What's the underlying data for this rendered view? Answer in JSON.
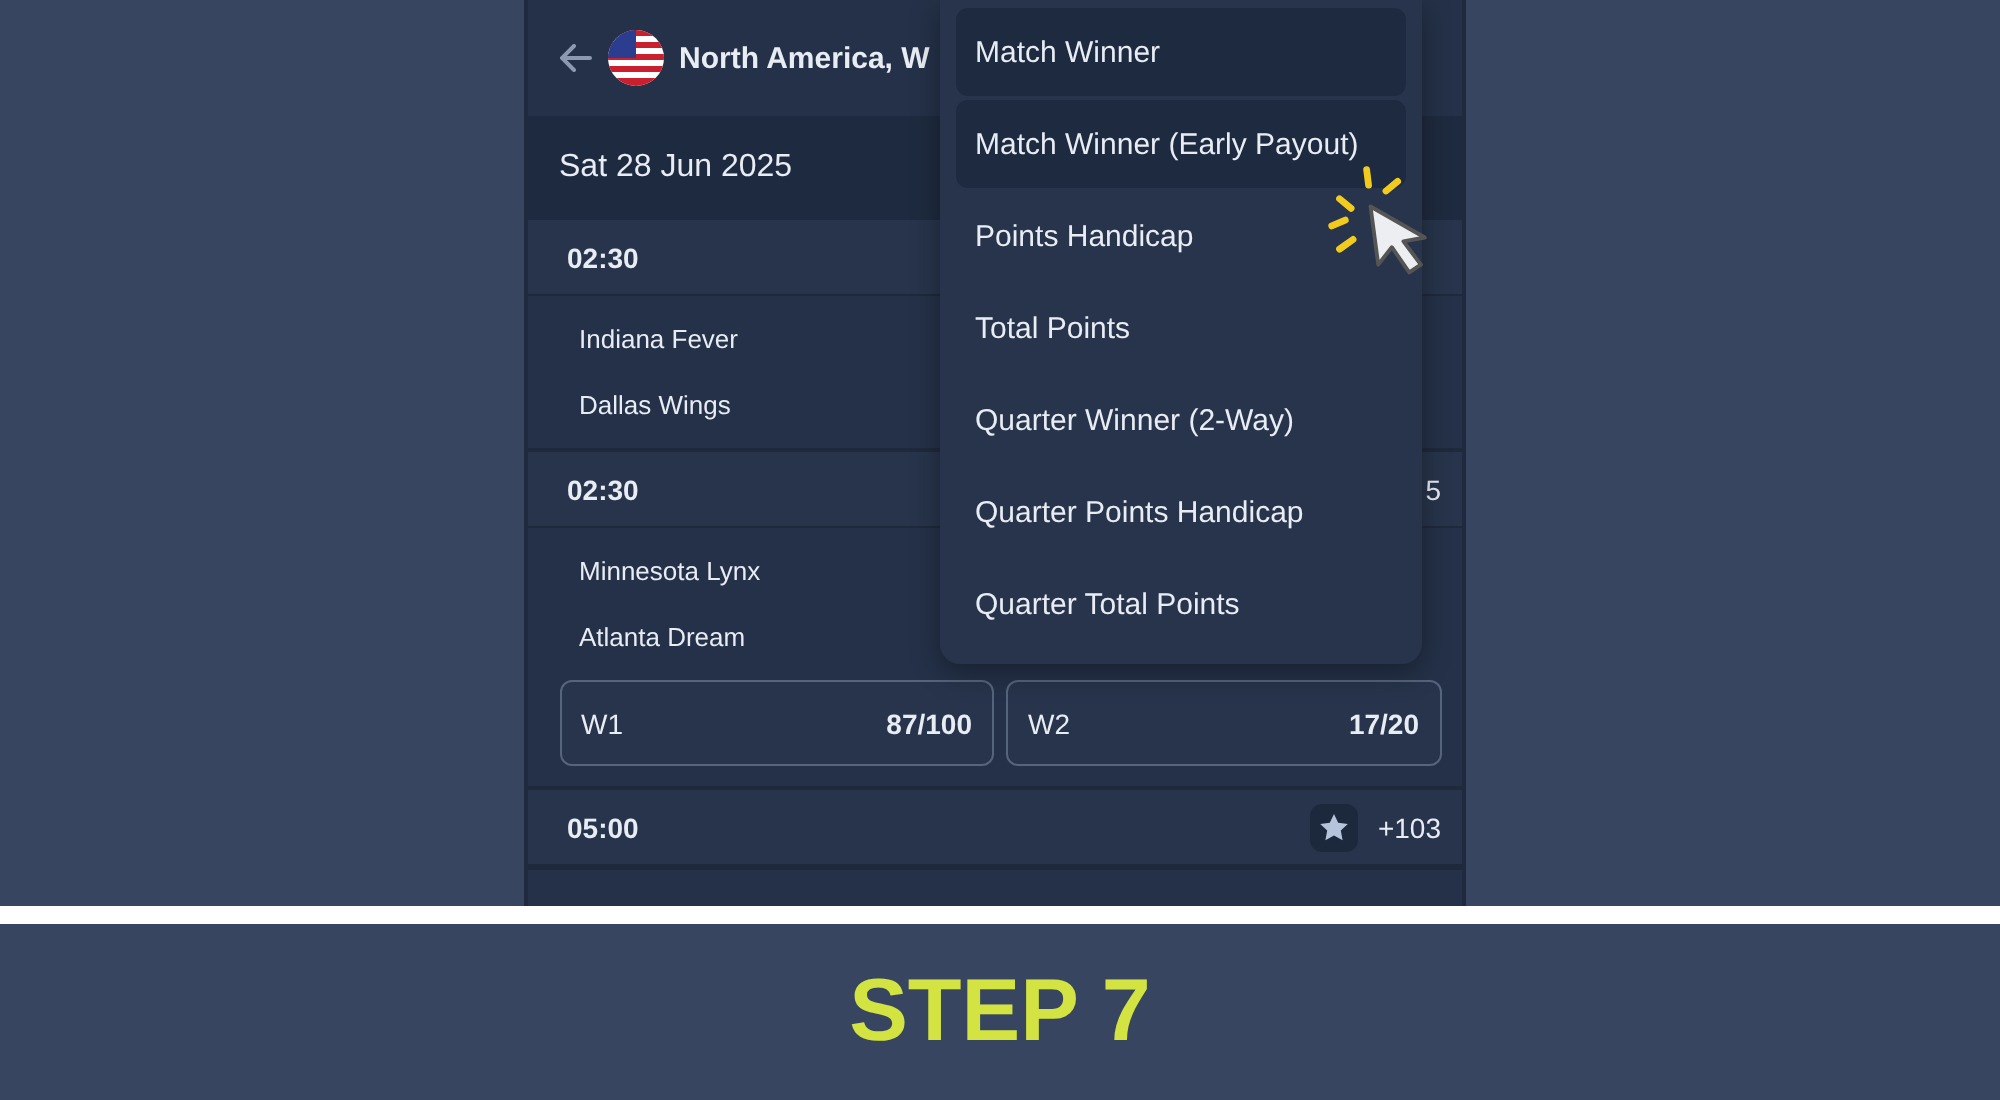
{
  "header": {
    "title": "North America, W"
  },
  "date": "Sat 28 Jun 2025",
  "matches": [
    {
      "time": "02:30",
      "teams": [
        "Indiana Fever",
        "Dallas Wings"
      ]
    },
    {
      "time": "02:30",
      "extra": "5",
      "teams": [
        "Minnesota Lynx",
        "Atlanta Dream"
      ],
      "odds": [
        {
          "label": "W1",
          "value": "87/100"
        },
        {
          "label": "W2",
          "value": "17/20"
        }
      ]
    },
    {
      "time": "05:00",
      "favorite": true,
      "extra": "+103"
    }
  ],
  "dropdown": [
    {
      "label": "Match Winner",
      "highlighted": true
    },
    {
      "label": "Match Winner (Early Payout)",
      "highlighted": true
    },
    {
      "label": "Points Handicap",
      "highlighted": false
    },
    {
      "label": "Total Points",
      "highlighted": false
    },
    {
      "label": "Quarter Winner (2-Way)",
      "highlighted": false
    },
    {
      "label": "Quarter Points Handicap",
      "highlighted": false
    },
    {
      "label": "Quarter Total Points",
      "highlighted": false
    }
  ],
  "banner": "STEP 7"
}
